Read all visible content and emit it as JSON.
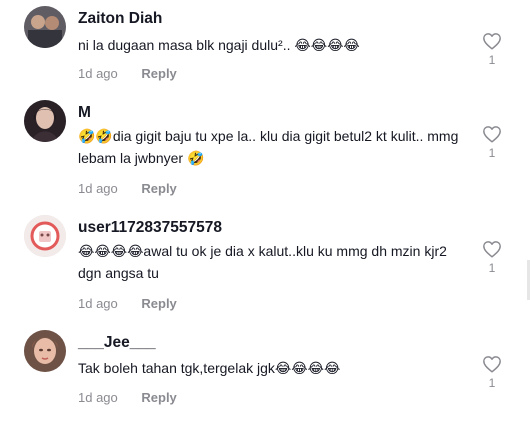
{
  "comments": [
    {
      "username": "Zaiton Diah",
      "text": "ni la dugaan masa blk ngaji dulu².. 😂😂😂😂",
      "time": "1d ago",
      "reply": "Reply",
      "likes": "1",
      "avatar_icon": "avatar-photo-icon",
      "avatar_colors": [
        "#6b6a6f",
        "#b89d86"
      ]
    },
    {
      "username": "M",
      "text": "🤣🤣dia gigit baju tu xpe la.. klu dia gigit betul2 kt kulit.. mmg lebam la jwbnyer 🤣",
      "time": "1d ago",
      "reply": "Reply",
      "likes": "1",
      "avatar_icon": "avatar-photo-icon",
      "avatar_colors": [
        "#2b2227",
        "#d8b7a6"
      ]
    },
    {
      "username": "user1172837557578",
      "text": "😂😂😂😂awal tu ok je dia x kalut..klu ku mmg dh mzin kjr2 dgn angsa tu",
      "time": "1d ago",
      "reply": "Reply",
      "likes": "1",
      "avatar_icon": "avatar-photo-icon",
      "avatar_colors": [
        "#f2e6e4",
        "#e35a5a"
      ]
    },
    {
      "username": "___Jee___",
      "text": "Tak boleh tahan tgk,tergelak jgk😂😂😂😂",
      "time": "1d ago",
      "reply": "Reply",
      "likes": "1",
      "avatar_icon": "avatar-photo-icon",
      "avatar_colors": [
        "#7a5a4c",
        "#e7b8a2"
      ]
    }
  ],
  "icons": {
    "like": "heart-outline-icon"
  }
}
